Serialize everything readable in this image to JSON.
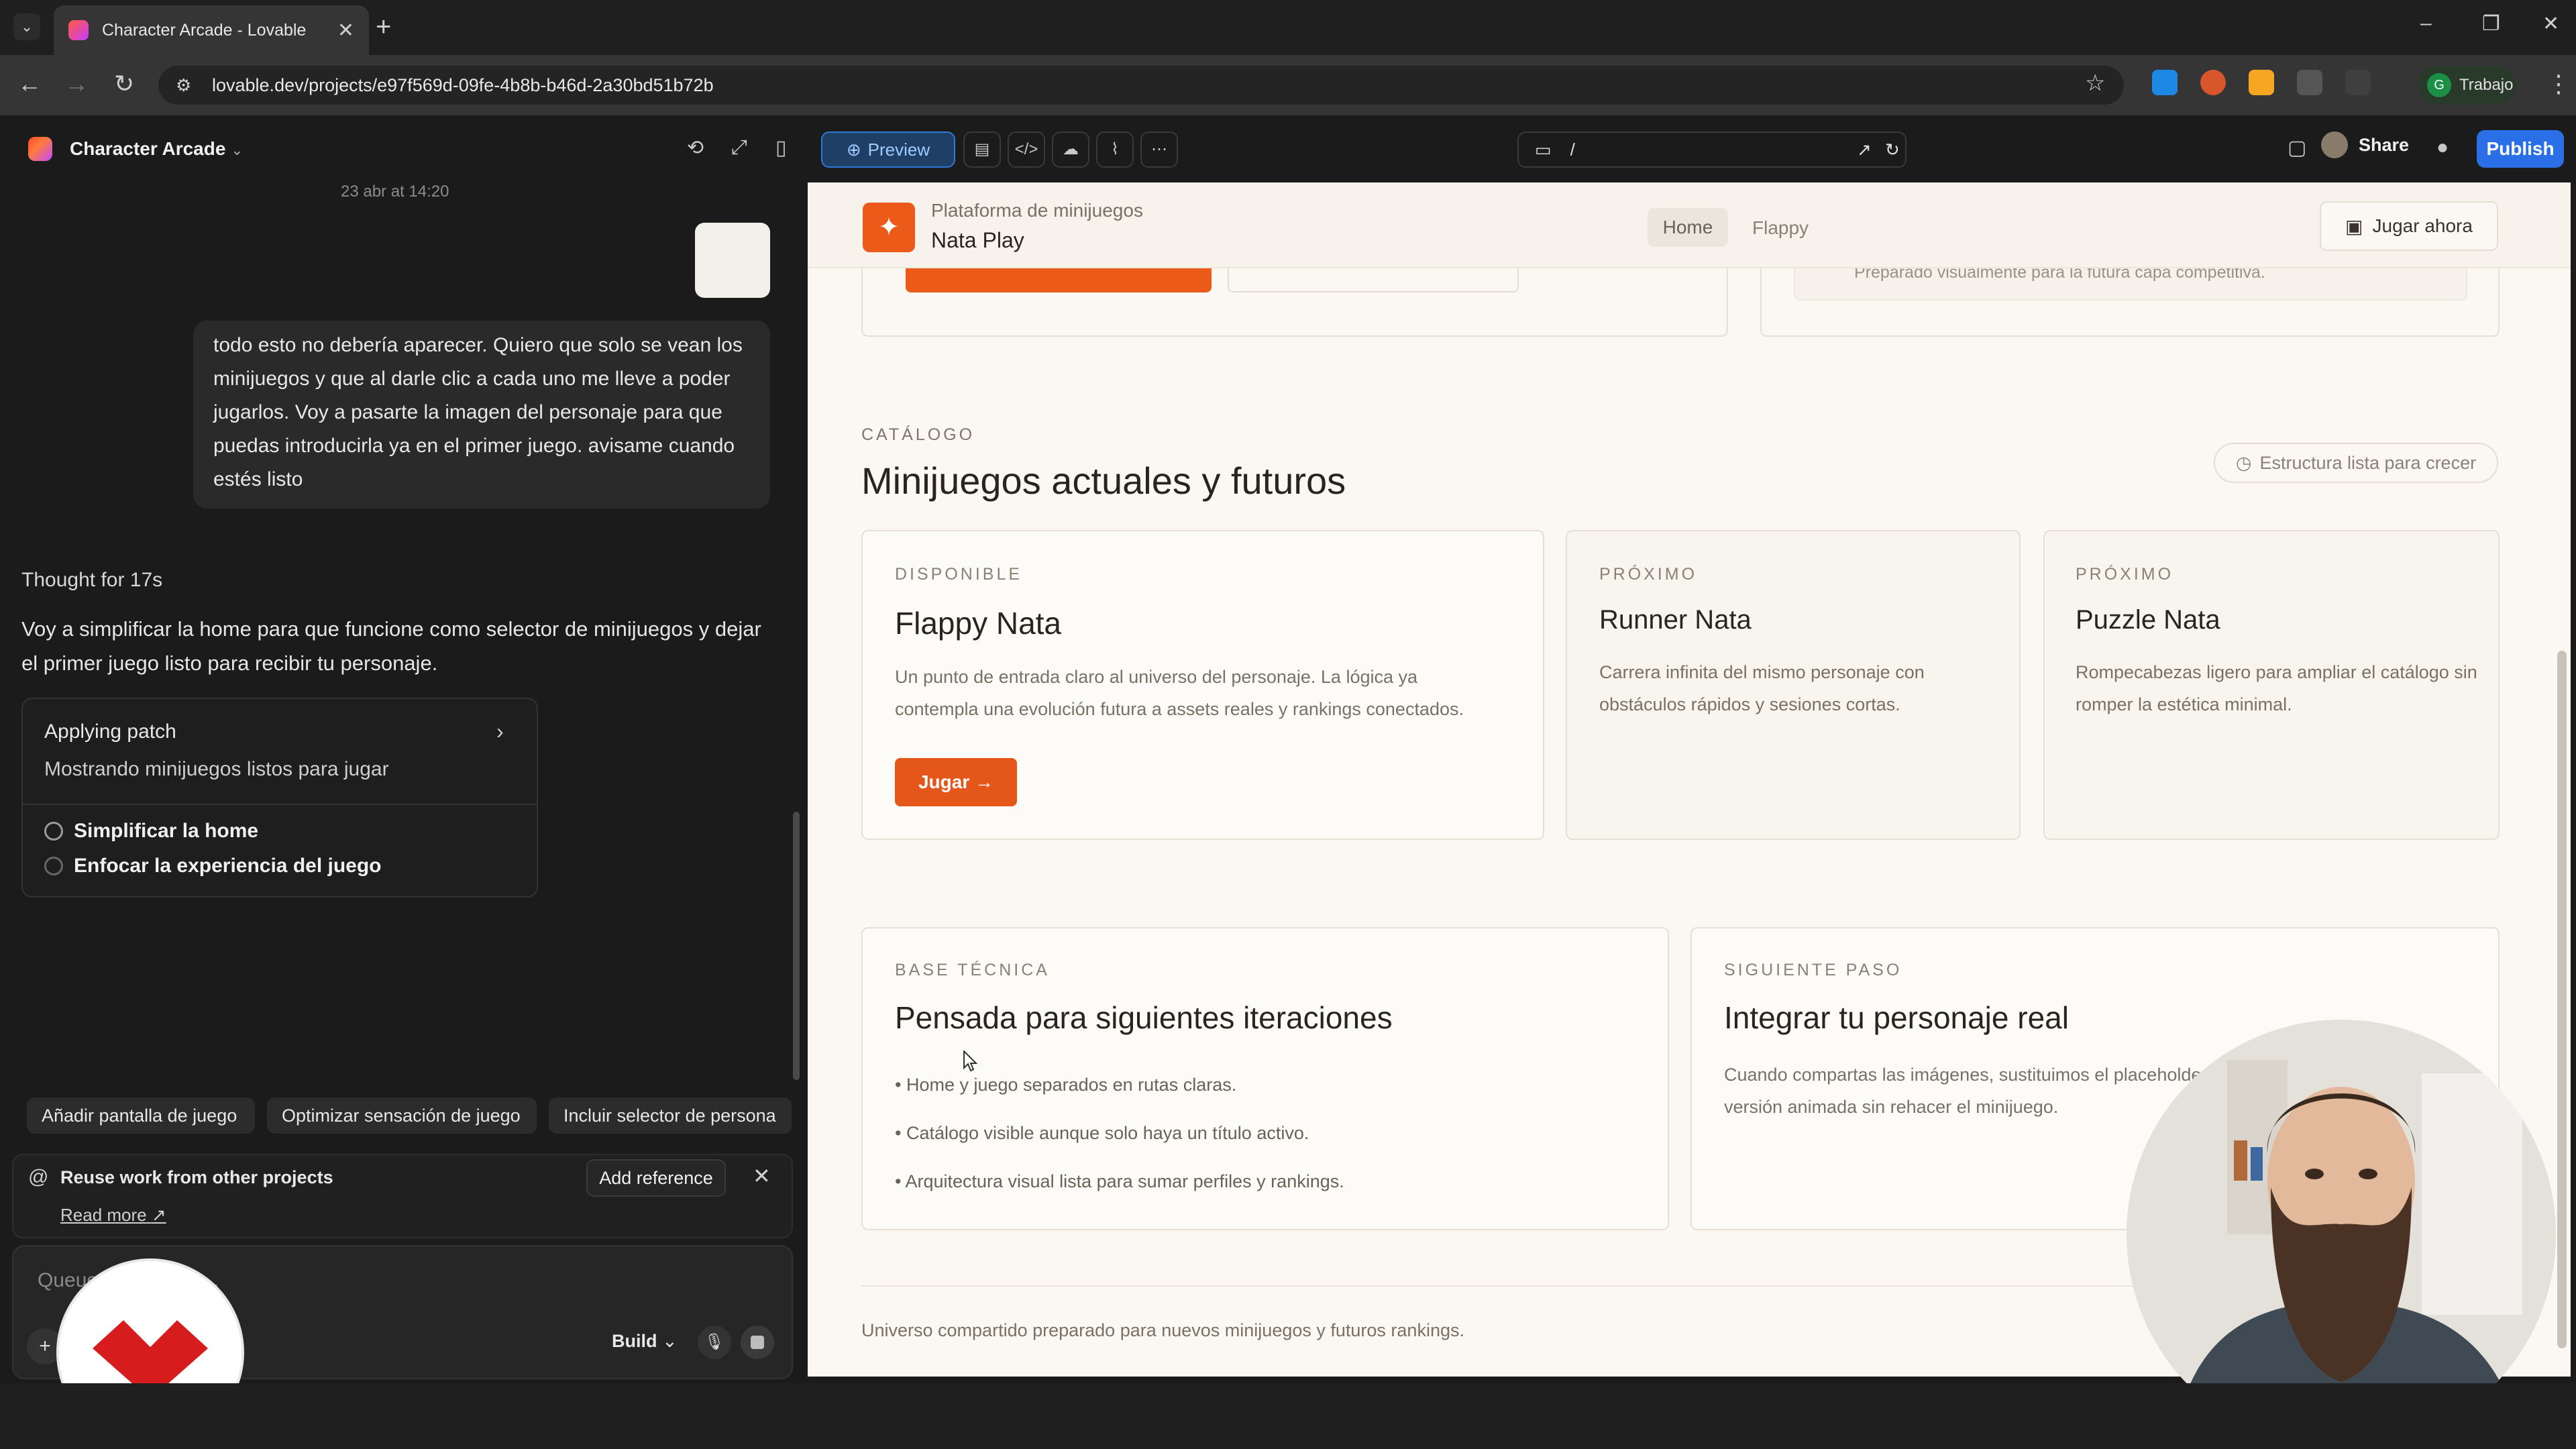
{
  "browser": {
    "tab_title": "Character Arcade - Lovable",
    "url": "lovable.dev/projects/e97f569d-09fe-4b8b-b46d-2a30bd51b72b",
    "profile_label": "Trabajo",
    "profile_initial": "G"
  },
  "app": {
    "project_name": "Character Arcade",
    "preview_label": "Preview",
    "route": "/",
    "share_label": "Share",
    "publish_label": "Publish"
  },
  "chat": {
    "timestamp": "23 abr at 14:20",
    "user_message": "todo esto no debería aparecer. Quiero que solo se vean los minijuegos y que al darle clic a cada uno me lleve a poder jugarlos. Voy a pasarte la imagen del personaje para que puedas introducirla ya en el primer juego. avisame cuando estés listo",
    "thought": "Thought for 17s",
    "ai_message": "Voy a simplificar la home para que funcione como selector de minijuegos y dejar el primer juego listo para recibir tu personaje.",
    "patch": {
      "title": "Applying patch",
      "subtitle": "Mostrando minijuegos listos para jugar",
      "steps": [
        "Simplificar la home",
        "Enfocar la experiencia del juego"
      ]
    },
    "suggestions": [
      "Añadir pantalla de juego",
      "Optimizar sensación de juego",
      "Incluir selector de persona"
    ],
    "reuse": {
      "title": "Reuse work from other projects",
      "add_reference": "Add reference",
      "read_more": "Read more"
    },
    "input_placeholder": "Queue a message...",
    "mode_label": "Build"
  },
  "site": {
    "brand_sub": "Plataforma de minijuegos",
    "brand_name": "Nata Play",
    "nav": [
      "Home",
      "Flappy"
    ],
    "play_now": "Jugar ahora",
    "top_right_text": "Preparado visualmente para la futura capa competitiva.",
    "catalog_label": "CATÁLOGO",
    "catalog_title": "Minijuegos actuales y futuros",
    "catalog_badge": "Estructura lista para crecer",
    "games": [
      {
        "label": "DISPONIBLE",
        "title": "Flappy Nata",
        "desc": "Un punto de entrada claro al universo del personaje. La lógica ya contempla una evolución futura a assets reales y rankings conectados.",
        "button": "Jugar"
      },
      {
        "label": "PRÓXIMO",
        "title": "Runner Nata",
        "desc": "Carrera infinita del mismo personaje con obstáculos rápidos y sesiones cortas."
      },
      {
        "label": "PRÓXIMO",
        "title": "Puzzle Nata",
        "desc": "Rompecabezas ligero para ampliar el catálogo sin romper la estética minimal."
      }
    ],
    "tech": {
      "label": "BASE TÉCNICA",
      "title": "Pensada para siguientes iteraciones",
      "bullets": [
        "• Home y juego separados en rutas claras.",
        "• Catálogo visible aunque solo haya un título activo.",
        "• Arquitectura visual lista para sumar perfiles y rankings."
      ]
    },
    "next": {
      "label": "SIGUIENTE PASO",
      "title": "Integrar tu personaje real",
      "desc": "Cuando compartas las imágenes, sustituimos el placeholder y dejamos preparada la versión animada sin rehacer el minijuego."
    },
    "footer": "Universo compartido preparado para nuevos minijuegos y futuros rankings."
  },
  "colors": {
    "accent_orange": "#e4561a",
    "publish_blue": "#2b6fe8",
    "preview_blue": "#1f3f66"
  },
  "icons": [
    "history-icon",
    "expand-icon",
    "sidebar-icon",
    "globe-icon",
    "file-icon",
    "code-icon",
    "cloud-icon",
    "chart-icon",
    "more-icon",
    "monitor-icon",
    "external-link-icon",
    "refresh-icon",
    "github-icon",
    "gamepad-icon",
    "clock-icon",
    "arrow-right-icon",
    "sparkle-icon"
  ]
}
